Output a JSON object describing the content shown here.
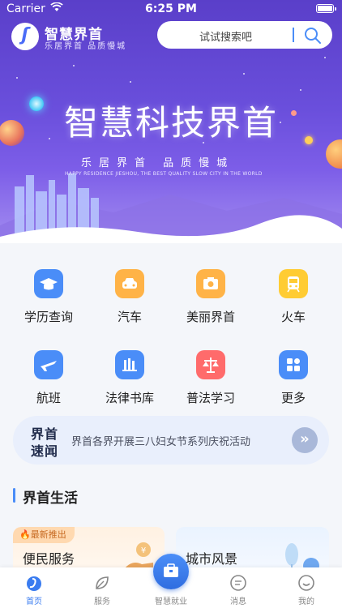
{
  "status_bar": {
    "carrier": "Carrier",
    "time": "6:25 PM"
  },
  "header": {
    "brand_name": "智慧界首",
    "brand_sub": "乐居界首  品质慢城",
    "search_placeholder": "试试搜索吧"
  },
  "banner": {
    "title": "智慧科技界首",
    "slogan": "乐居界首  品质慢城",
    "english": "HAPPY RESIDENCE JIESHOU, THE BEST QUALITY SLOW CITY IN THE WORLD"
  },
  "services": [
    {
      "label": "学历查询",
      "icon": "graduation-cap-icon",
      "color": "#4a8df8"
    },
    {
      "label": "汽车",
      "icon": "car-icon",
      "color": "#ffb347"
    },
    {
      "label": "美丽界首",
      "icon": "camera-icon",
      "color": "#ffb347"
    },
    {
      "label": "火车",
      "icon": "train-icon",
      "color": "#ffcc33"
    },
    {
      "label": "航班",
      "icon": "airplane-icon",
      "color": "#4a8df8"
    },
    {
      "label": "法律书库",
      "icon": "books-icon",
      "color": "#4a8df8"
    },
    {
      "label": "普法学习",
      "icon": "scales-icon",
      "color": "#ff6b6b"
    },
    {
      "label": "更多",
      "icon": "grid-icon",
      "color": "#4a8df8"
    }
  ],
  "news": {
    "badge_line1": "界首",
    "badge_line2": "速闻",
    "text": "界首各界开展三八妇女节系列庆祝活动"
  },
  "section": {
    "title": "界首生活",
    "cards": [
      {
        "tag": "最新推出",
        "title": "便民服务"
      },
      {
        "title": "城市风景"
      }
    ]
  },
  "tabbar": {
    "items": [
      {
        "label": "首页",
        "active": true
      },
      {
        "label": "服务"
      },
      {
        "label": "智慧就业"
      },
      {
        "label": "消息"
      },
      {
        "label": "我的"
      }
    ]
  },
  "colors": {
    "accent": "#3a7cf0",
    "hero": "#6a4fdc"
  }
}
